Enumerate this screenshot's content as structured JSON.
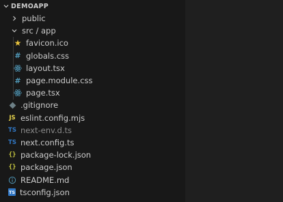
{
  "explorer": {
    "section_title": "DEMOAPP",
    "items": [
      {
        "label": "public",
        "type": "folder",
        "state": "collapsed"
      },
      {
        "label": "src / app",
        "type": "folder",
        "state": "expanded"
      },
      {
        "label": "favicon.ico",
        "icon": "star-icon"
      },
      {
        "label": "globals.css",
        "icon": "css-hash-icon"
      },
      {
        "label": "layout.tsx",
        "icon": "react-icon"
      },
      {
        "label": "page.module.css",
        "icon": "css-hash-icon"
      },
      {
        "label": "page.tsx",
        "icon": "react-icon"
      },
      {
        "label": ".gitignore",
        "icon": "git-icon"
      },
      {
        "label": "eslint.config.mjs",
        "icon": "js-icon"
      },
      {
        "label": "next-env.d.ts",
        "icon": "ts-icon",
        "dimmed": true
      },
      {
        "label": "next.config.ts",
        "icon": "ts-icon"
      },
      {
        "label": "package-lock.json",
        "icon": "json-braces-icon"
      },
      {
        "label": "package.json",
        "icon": "json-braces-icon"
      },
      {
        "label": "README.md",
        "icon": "info-icon"
      },
      {
        "label": "tsconfig.json",
        "icon": "tsconfig-icon"
      }
    ],
    "icon_glyphs": {
      "js": "JS",
      "ts": "TS",
      "json": "{}",
      "css": "#",
      "tsconfig": "TS"
    }
  },
  "colors": {
    "sidebar_bg": "#181818",
    "editor_bg": "#1f1f1f",
    "text": "#cccccc",
    "dim_text": "#8c8c8c",
    "ts_blue": "#3178c6",
    "js_yellow": "#e8d44d",
    "json_yellow": "#cbcb41",
    "css_blue": "#519aba"
  }
}
